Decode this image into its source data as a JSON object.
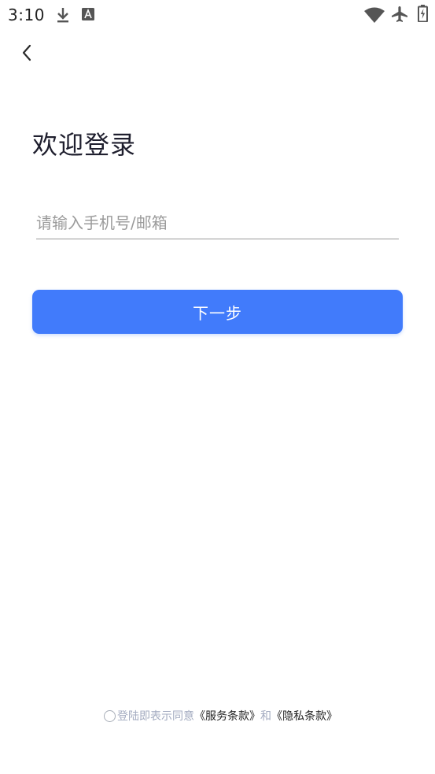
{
  "status_bar": {
    "time": "3:10",
    "icons": [
      "download-icon",
      "text-a-icon",
      "wifi-icon",
      "airplane-icon",
      "battery-charging-icon"
    ]
  },
  "header": {
    "back_icon": "chevron-left-icon",
    "title": "欢迎登录"
  },
  "form": {
    "account_placeholder": "请输入手机号/邮箱",
    "account_value": "",
    "next_label": "下一步"
  },
  "agreement": {
    "checked": false,
    "prefix": "登陆即表示同意",
    "terms_link": "《服务条款》",
    "conjunction": "和",
    "privacy_link": "《隐私条款》"
  },
  "colors": {
    "primary": "#417bfb",
    "muted_text": "#a3abc0",
    "title_text": "#1f1f2e"
  }
}
